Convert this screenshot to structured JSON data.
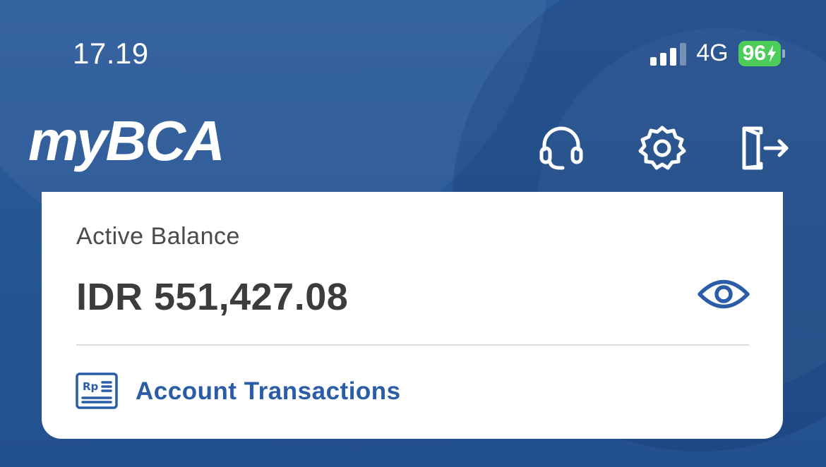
{
  "status_bar": {
    "time": "17.19",
    "network": "4G",
    "battery": "96"
  },
  "header": {
    "logo_my": "my",
    "logo_bca": "BCA",
    "icons": [
      "headset-icon",
      "gear-icon",
      "logout-icon"
    ]
  },
  "balance_card": {
    "label": "Active Balance",
    "value": "IDR 551,427.08",
    "toggle_icon": "eye-icon",
    "transactions_label": "Account Transactions",
    "transactions_icon": "rp-receipt-icon"
  },
  "colors": {
    "brand_blue": "#2a5a98",
    "link_blue": "#2a5ca8",
    "battery_green": "#4ccd5a"
  }
}
